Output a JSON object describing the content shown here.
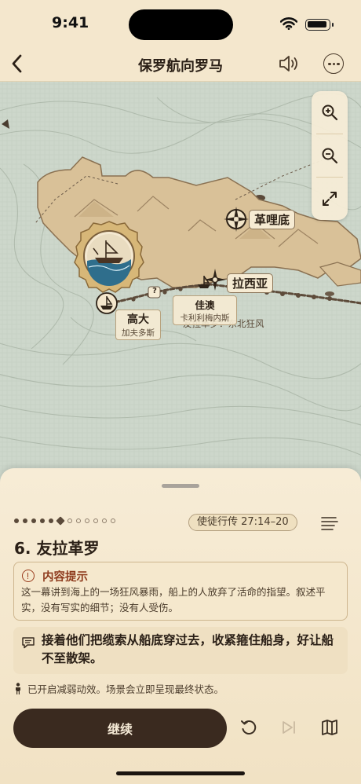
{
  "status_bar": {
    "time": "9:41"
  },
  "nav": {
    "title": "保罗航向罗马"
  },
  "map": {
    "labels": {
      "phoenix": "革哩底",
      "lasea": "拉西亚",
      "fair_havens": "佳澳",
      "fair_havens_sub": "卡利利梅内斯",
      "cauda": "高大",
      "cauda_sub": "加夫多斯",
      "wind_note": "友拉革罗：东北狂风",
      "question_mark": "?"
    }
  },
  "sheet": {
    "progress": {
      "total": 12,
      "current": 6
    },
    "reference": "使徒行传 27:14–20",
    "section_title": "6. 友拉革罗",
    "notice": {
      "title": "内容提示",
      "body": "这一幕讲到海上的一场狂风暴雨，船上的人放弃了活命的指望。叙述平实，没有写实的细节；没有人受伤。"
    },
    "narration": "接着他们把缆索从船底穿过去，收紧箍住船身，好让船不至散架。",
    "motion_note": "已开启减弱动效。场景会立即呈现最终状态。",
    "continue_label": "继续"
  }
}
